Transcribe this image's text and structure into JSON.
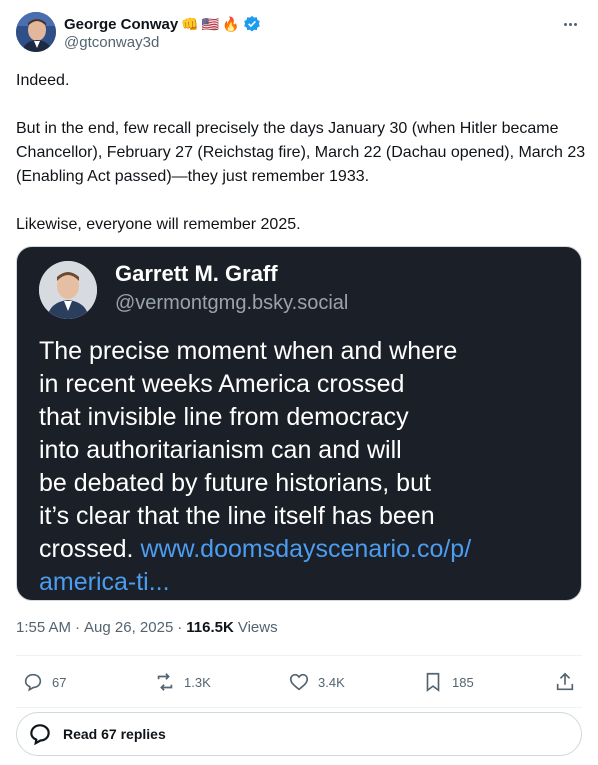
{
  "author": {
    "name": "George Conway",
    "emojis": [
      "👊",
      "🇺🇸",
      "🔥"
    ],
    "handle": "@gtconway3d"
  },
  "tweet": {
    "paragraphs": [
      "Indeed.",
      "But in the end, few recall precisely the days January 30 (when Hitler became Chancellor), February 27 (Reichstag fire), March 22 (Dachau opened), March 23 (Enabling Act passed)—they just remember 1933.",
      "Likewise, everyone will remember 2025."
    ]
  },
  "quoted": {
    "name": "Garrett M. Graff",
    "handle": "@vermontgmg.bsky.social",
    "lines": [
      "The precise moment when and where",
      "in recent weeks America crossed",
      "that invisible line from democracy",
      "into authoritarianism can and will",
      "be debated by future historians, but",
      "it’s clear that the line itself has been"
    ],
    "last_line_text": "crossed.",
    "link_part1": "www.doomsdayscenario.co/p/",
    "link_part2": "america-ti..."
  },
  "meta": {
    "time": "1:55 AM",
    "sep1": "·",
    "date": "Aug 26, 2025",
    "sep2": "·",
    "views_count": "116.5K",
    "views_label": "Views"
  },
  "actions": {
    "replies": "67",
    "reposts": "1.3K",
    "likes": "3.4K",
    "bookmarks": "185"
  },
  "read_replies_label": "Read 67 replies",
  "colors": {
    "verified": "#1d9bf0",
    "link": "#4c9cf0",
    "card_bg": "#1b2028"
  }
}
